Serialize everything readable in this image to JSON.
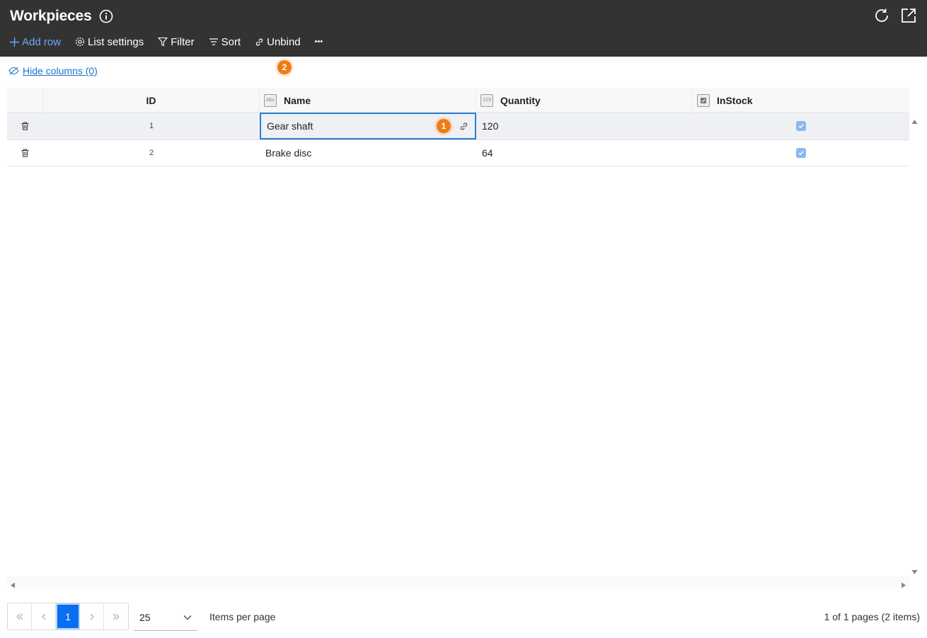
{
  "header": {
    "title": "Workpieces",
    "colors": {
      "background": "#333333",
      "accent": "#6aa9ff",
      "badge": "#f07b13"
    },
    "toolbar": {
      "add_row": "Add row",
      "list_settings": "List settings",
      "filter": "Filter",
      "sort": "Sort",
      "unbind": "Unbind",
      "more": "•••"
    }
  },
  "badges": {
    "first": "1",
    "second": "2"
  },
  "hide_columns": "Hide columns (0)",
  "grid": {
    "columns": [
      {
        "label": "ID",
        "type_icon": ""
      },
      {
        "label": "Name",
        "type_icon": "Abc"
      },
      {
        "label": "Quantity",
        "type_icon": "123"
      },
      {
        "label": "InStock",
        "type_icon": "checkbox-icon"
      }
    ],
    "rows": [
      {
        "id": "1",
        "name": "Gear shaft",
        "quantity": "120",
        "in_stock": true
      },
      {
        "id": "2",
        "name": "Brake disc",
        "quantity": "64",
        "in_stock": true
      }
    ]
  },
  "pagination": {
    "current_page": "1",
    "per_page": "25",
    "per_page_label": "Items per page",
    "info": "1 of 1 pages (2 items)"
  }
}
